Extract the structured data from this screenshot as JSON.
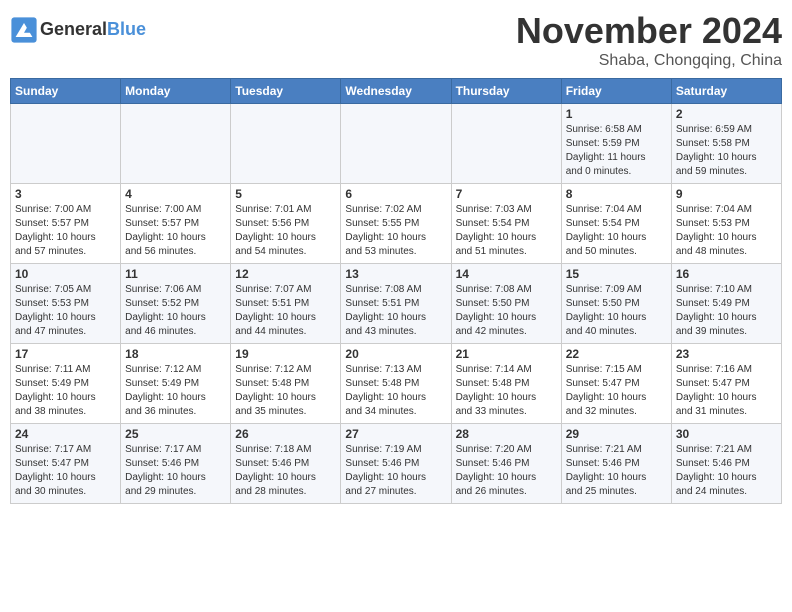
{
  "header": {
    "logo_general": "General",
    "logo_blue": "Blue",
    "month_title": "November 2024",
    "subtitle": "Shaba, Chongqing, China"
  },
  "days_of_week": [
    "Sunday",
    "Monday",
    "Tuesday",
    "Wednesday",
    "Thursday",
    "Friday",
    "Saturday"
  ],
  "weeks": [
    {
      "cells": [
        {
          "day": null,
          "text": null
        },
        {
          "day": null,
          "text": null
        },
        {
          "day": null,
          "text": null
        },
        {
          "day": null,
          "text": null
        },
        {
          "day": null,
          "text": null
        },
        {
          "day": "1",
          "text": "Sunrise: 6:58 AM\nSunset: 5:59 PM\nDaylight: 11 hours\nand 0 minutes."
        },
        {
          "day": "2",
          "text": "Sunrise: 6:59 AM\nSunset: 5:58 PM\nDaylight: 10 hours\nand 59 minutes."
        }
      ]
    },
    {
      "cells": [
        {
          "day": "3",
          "text": "Sunrise: 7:00 AM\nSunset: 5:57 PM\nDaylight: 10 hours\nand 57 minutes."
        },
        {
          "day": "4",
          "text": "Sunrise: 7:00 AM\nSunset: 5:57 PM\nDaylight: 10 hours\nand 56 minutes."
        },
        {
          "day": "5",
          "text": "Sunrise: 7:01 AM\nSunset: 5:56 PM\nDaylight: 10 hours\nand 54 minutes."
        },
        {
          "day": "6",
          "text": "Sunrise: 7:02 AM\nSunset: 5:55 PM\nDaylight: 10 hours\nand 53 minutes."
        },
        {
          "day": "7",
          "text": "Sunrise: 7:03 AM\nSunset: 5:54 PM\nDaylight: 10 hours\nand 51 minutes."
        },
        {
          "day": "8",
          "text": "Sunrise: 7:04 AM\nSunset: 5:54 PM\nDaylight: 10 hours\nand 50 minutes."
        },
        {
          "day": "9",
          "text": "Sunrise: 7:04 AM\nSunset: 5:53 PM\nDaylight: 10 hours\nand 48 minutes."
        }
      ]
    },
    {
      "cells": [
        {
          "day": "10",
          "text": "Sunrise: 7:05 AM\nSunset: 5:53 PM\nDaylight: 10 hours\nand 47 minutes."
        },
        {
          "day": "11",
          "text": "Sunrise: 7:06 AM\nSunset: 5:52 PM\nDaylight: 10 hours\nand 46 minutes."
        },
        {
          "day": "12",
          "text": "Sunrise: 7:07 AM\nSunset: 5:51 PM\nDaylight: 10 hours\nand 44 minutes."
        },
        {
          "day": "13",
          "text": "Sunrise: 7:08 AM\nSunset: 5:51 PM\nDaylight: 10 hours\nand 43 minutes."
        },
        {
          "day": "14",
          "text": "Sunrise: 7:08 AM\nSunset: 5:50 PM\nDaylight: 10 hours\nand 42 minutes."
        },
        {
          "day": "15",
          "text": "Sunrise: 7:09 AM\nSunset: 5:50 PM\nDaylight: 10 hours\nand 40 minutes."
        },
        {
          "day": "16",
          "text": "Sunrise: 7:10 AM\nSunset: 5:49 PM\nDaylight: 10 hours\nand 39 minutes."
        }
      ]
    },
    {
      "cells": [
        {
          "day": "17",
          "text": "Sunrise: 7:11 AM\nSunset: 5:49 PM\nDaylight: 10 hours\nand 38 minutes."
        },
        {
          "day": "18",
          "text": "Sunrise: 7:12 AM\nSunset: 5:49 PM\nDaylight: 10 hours\nand 36 minutes."
        },
        {
          "day": "19",
          "text": "Sunrise: 7:12 AM\nSunset: 5:48 PM\nDaylight: 10 hours\nand 35 minutes."
        },
        {
          "day": "20",
          "text": "Sunrise: 7:13 AM\nSunset: 5:48 PM\nDaylight: 10 hours\nand 34 minutes."
        },
        {
          "day": "21",
          "text": "Sunrise: 7:14 AM\nSunset: 5:48 PM\nDaylight: 10 hours\nand 33 minutes."
        },
        {
          "day": "22",
          "text": "Sunrise: 7:15 AM\nSunset: 5:47 PM\nDaylight: 10 hours\nand 32 minutes."
        },
        {
          "day": "23",
          "text": "Sunrise: 7:16 AM\nSunset: 5:47 PM\nDaylight: 10 hours\nand 31 minutes."
        }
      ]
    },
    {
      "cells": [
        {
          "day": "24",
          "text": "Sunrise: 7:17 AM\nSunset: 5:47 PM\nDaylight: 10 hours\nand 30 minutes."
        },
        {
          "day": "25",
          "text": "Sunrise: 7:17 AM\nSunset: 5:46 PM\nDaylight: 10 hours\nand 29 minutes."
        },
        {
          "day": "26",
          "text": "Sunrise: 7:18 AM\nSunset: 5:46 PM\nDaylight: 10 hours\nand 28 minutes."
        },
        {
          "day": "27",
          "text": "Sunrise: 7:19 AM\nSunset: 5:46 PM\nDaylight: 10 hours\nand 27 minutes."
        },
        {
          "day": "28",
          "text": "Sunrise: 7:20 AM\nSunset: 5:46 PM\nDaylight: 10 hours\nand 26 minutes."
        },
        {
          "day": "29",
          "text": "Sunrise: 7:21 AM\nSunset: 5:46 PM\nDaylight: 10 hours\nand 25 minutes."
        },
        {
          "day": "30",
          "text": "Sunrise: 7:21 AM\nSunset: 5:46 PM\nDaylight: 10 hours\nand 24 minutes."
        }
      ]
    }
  ]
}
